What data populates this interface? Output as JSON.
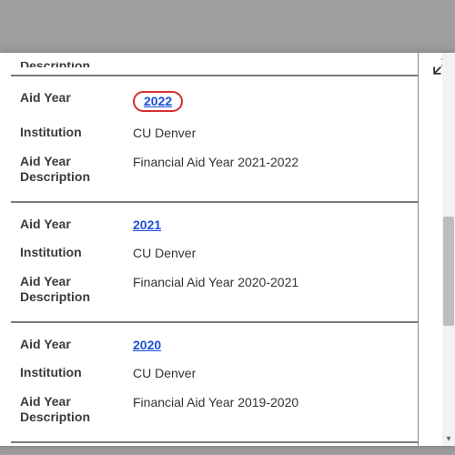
{
  "labels": {
    "aid_year": "Aid Year",
    "institution": "Institution",
    "aid_year_description": "Aid Year Description",
    "partial_top": "Description"
  },
  "records": [
    {
      "aid_year": "2022",
      "institution": "CU Denver",
      "description": "Financial Aid Year 2021-2022",
      "highlighted": true
    },
    {
      "aid_year": "2021",
      "institution": "CU Denver",
      "description": "Financial Aid Year 2020-2021",
      "highlighted": false
    },
    {
      "aid_year": "2020",
      "institution": "CU Denver",
      "description": "Financial Aid Year 2019-2020",
      "highlighted": false
    }
  ]
}
